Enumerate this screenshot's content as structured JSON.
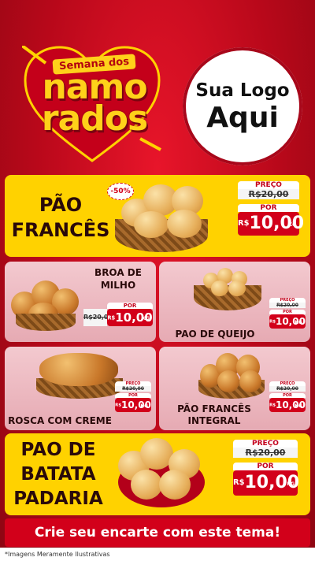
{
  "header": {
    "campaign_top": "Semana dos",
    "campaign_line1": "namo",
    "campaign_line2": "rados",
    "logo_line1": "Sua Logo",
    "logo_line2": "Aqui"
  },
  "products": [
    {
      "name_l1": "PÃO",
      "name_l2": "FRANCÊS",
      "badge": "-50%",
      "price_label": "PREÇO",
      "old_price": "R$20,00",
      "por_label": "POR",
      "currency": "R$",
      "new_price": "10,00",
      "unit": "KG"
    },
    {
      "name_l1": "BROA DE",
      "name_l2": "MILHO",
      "price_label": "",
      "old_price": "R$20,00",
      "por_label": "POR",
      "currency": "R$",
      "new_price": "10,00",
      "unit": "KG"
    },
    {
      "name_l1": "PAO DE QUEIJO",
      "price_label": "PREÇO",
      "old_price": "R$20,00",
      "por_label": "POR",
      "currency": "R$",
      "new_price": "10,00",
      "unit": "KG"
    },
    {
      "name_l1": "ROSCA COM CREME",
      "price_label": "PREÇO",
      "old_price": "R$20,00",
      "por_label": "POR",
      "currency": "R$",
      "new_price": "10,00",
      "unit": "KG"
    },
    {
      "name_l1": "PÃO FRANCÊS",
      "name_l2": "INTEGRAL",
      "price_label": "PREÇO",
      "old_price": "R$20,00",
      "por_label": "POR",
      "currency": "R$",
      "new_price": "10,00",
      "unit": "KG"
    },
    {
      "name_l1": "PAO DE",
      "name_l2": "BATATA",
      "name_l3": "PADARIA",
      "price_label": "PREÇO",
      "old_price": "R$20,00",
      "por_label": "POR",
      "currency": "R$",
      "new_price": "10,00",
      "unit": "KG"
    }
  ],
  "cta": "Crie seu encarte com este tema!",
  "footnote": "*Imagens Meramente Ilustrativas",
  "colors": {
    "primary_red": "#d2001a",
    "yellow": "#ffd200",
    "pink": "#f3c9cf"
  }
}
